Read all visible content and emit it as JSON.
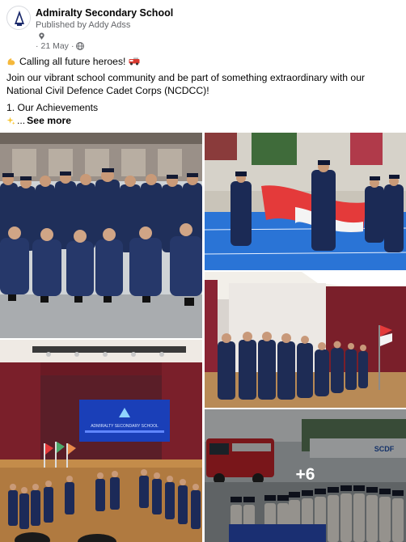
{
  "post": {
    "author": "Admiralty Secondary School",
    "published_by": "Published by Addy Adss",
    "date": "21 May",
    "dot": "·",
    "icons": [
      "school-crest-icon",
      "location-pin-icon",
      "globe-icon"
    ]
  },
  "text": {
    "line1": "Calling all future heroes!",
    "line2": "Join our vibrant school community and be part of something extraordinary with our National Civil Defence Cadet Corps (NCDCC)!",
    "line3": "1. Our Achievements",
    "line4_prefix": "...",
    "see_more": "See more",
    "emojis": [
      "flexed-biceps-icon",
      "fire-engine-icon",
      "sparkles-icon"
    ]
  },
  "photos": {
    "presentation_screen": "ADMIRALTY SECONDARY SCHOOL",
    "scdf_sign": "SCDF",
    "more_count": "+6",
    "colors": {
      "uniform": "#1f2f5a",
      "court": "#2a74d6",
      "curtain": "#7a1f2a",
      "accent": "#1877f2"
    }
  }
}
